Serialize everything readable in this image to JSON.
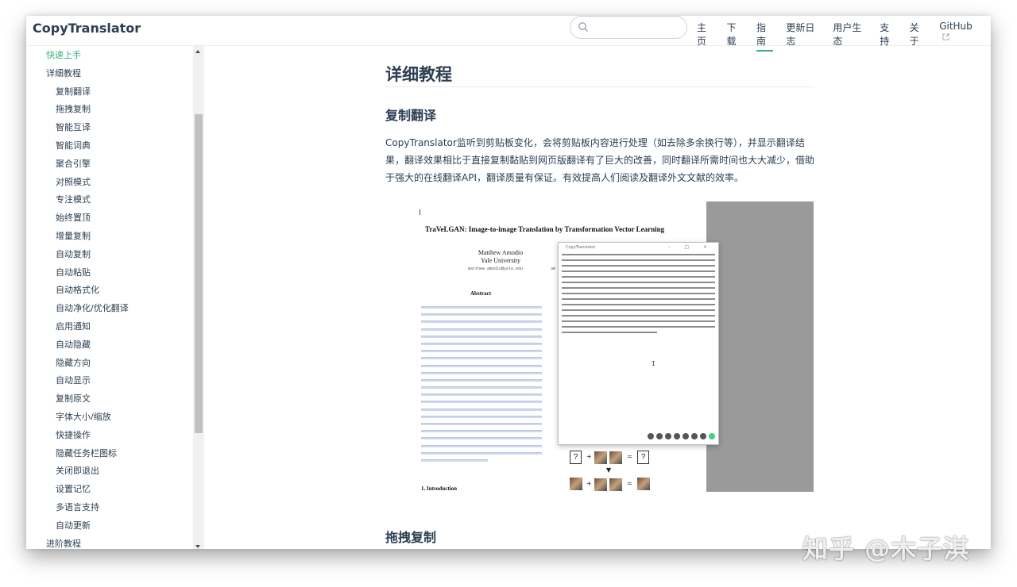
{
  "header": {
    "brand": "CopyTranslator",
    "search_placeholder": "",
    "nav": [
      "主页",
      "下载",
      "指南",
      "更新日志",
      "用户生态",
      "支持",
      "关于",
      "GitHub"
    ],
    "active_nav": "指南"
  },
  "sidebar": {
    "items": [
      {
        "label": "快速上手",
        "level": 1,
        "active": true
      },
      {
        "label": "详细教程",
        "level": 1
      },
      {
        "label": "复制翻译",
        "level": 2
      },
      {
        "label": "拖拽复制",
        "level": 2
      },
      {
        "label": "智能互译",
        "level": 2
      },
      {
        "label": "智能词典",
        "level": 2
      },
      {
        "label": "聚合引擎",
        "level": 2
      },
      {
        "label": "对照模式",
        "level": 2
      },
      {
        "label": "专注模式",
        "level": 2
      },
      {
        "label": "始终置顶",
        "level": 2
      },
      {
        "label": "增量复制",
        "level": 2
      },
      {
        "label": "自动复制",
        "level": 2
      },
      {
        "label": "自动粘贴",
        "level": 2
      },
      {
        "label": "自动格式化",
        "level": 2
      },
      {
        "label": "自动净化/优化翻译",
        "level": 2
      },
      {
        "label": "启用通知",
        "level": 2
      },
      {
        "label": "自动隐藏",
        "level": 2
      },
      {
        "label": "隐藏方向",
        "level": 2
      },
      {
        "label": "自动显示",
        "level": 2
      },
      {
        "label": "复制原文",
        "level": 2
      },
      {
        "label": "字体大小/缩放",
        "level": 2
      },
      {
        "label": "快捷操作",
        "level": 2
      },
      {
        "label": "隐藏任务栏图标",
        "level": 2
      },
      {
        "label": "关闭即退出",
        "level": 2
      },
      {
        "label": "设置记忆",
        "level": 2
      },
      {
        "label": "多语言支持",
        "level": 2
      },
      {
        "label": "自动更新",
        "level": 2
      },
      {
        "label": "进阶教程",
        "level": 1
      }
    ]
  },
  "main": {
    "title": "详细教程",
    "section1_title": "复制翻译",
    "section1_text": "CopyTranslator监听到剪贴板变化，会将剪贴板内容进行处理（如去除多余换行等），并显示翻译结果，翻译效果相比于直接复制黏贴到网页版翻译有了巨大的改善，同时翻译所需时间也大大减少，借助于强大的在线翻译API，翻译质量有保证。有效提高人们阅读及翻译外文文献的效率。",
    "section2_title": "拖拽复制"
  },
  "screenshot": {
    "paper_title": "TraVeLGAN: Image-to-image Translation by Transformation Vector Learning",
    "author_name": "Matthew Amodio",
    "author_affil": "Yale University",
    "author_email": "matthew.amodio@yale.edu",
    "author_email2": "am",
    "abstract_heading": "Abstract",
    "intro_heading": "1. Introduction",
    "window_title": "CopyTranslator",
    "window_controls": "- □ ×",
    "cursor_glyph": "I",
    "fig_unknown": "?",
    "fig_plus": "+",
    "fig_eq": "=",
    "fig_arrow": "▼"
  },
  "watermark": "知乎 @木子淇"
}
